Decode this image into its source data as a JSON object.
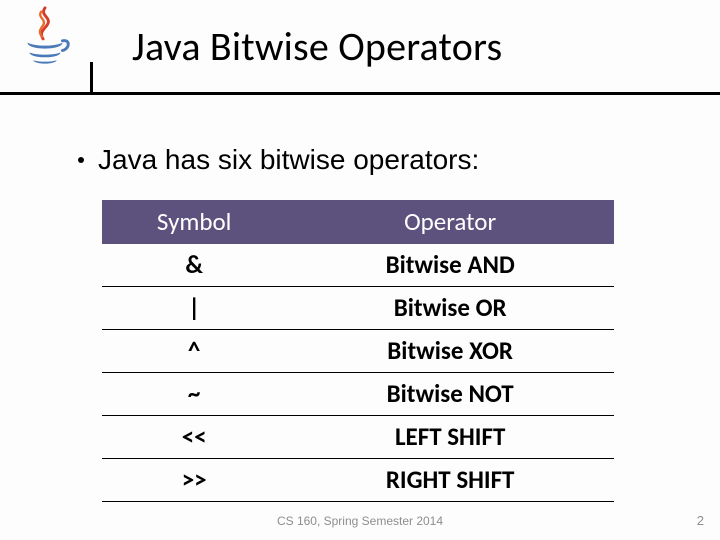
{
  "header": {
    "title": "Java Bitwise Operators"
  },
  "bullet": {
    "text": "Java has six bitwise operators:"
  },
  "table": {
    "headers": {
      "col1": "Symbol",
      "col2": "Operator"
    },
    "rows": [
      {
        "symbol": "&",
        "operator": "Bitwise AND"
      },
      {
        "symbol": "|",
        "operator": "Bitwise OR"
      },
      {
        "symbol": "^",
        "operator": "Bitwise XOR"
      },
      {
        "symbol": "~",
        "operator": "Bitwise NOT"
      },
      {
        "symbol": "<<",
        "operator": "LEFT SHIFT"
      },
      {
        "symbol": ">>",
        "operator": "RIGHT SHIFT"
      }
    ]
  },
  "footer": {
    "center": "CS 160, Spring Semester 2014",
    "page": "2"
  }
}
